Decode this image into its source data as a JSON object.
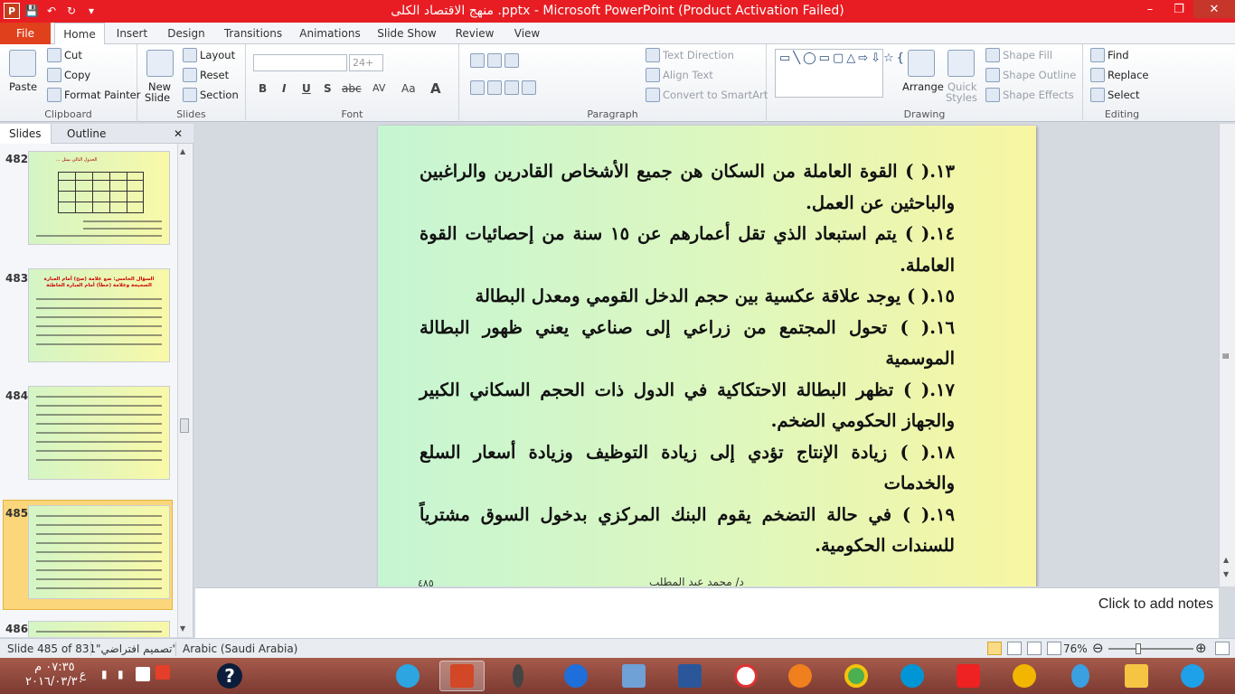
{
  "window": {
    "title": "منهج الاقتصاد الكلى .pptx - Microsoft PowerPoint (Product Activation Failed)",
    "minimize": "–",
    "restore": "❐",
    "close": "✕"
  },
  "qat": {
    "app_icon": "P",
    "save": "💾",
    "undo": "↶",
    "redo": "↻",
    "customize": "▾"
  },
  "tabs": [
    {
      "label": "File"
    },
    {
      "label": "Home"
    },
    {
      "label": "Insert"
    },
    {
      "label": "Design"
    },
    {
      "label": "Transitions"
    },
    {
      "label": "Animations"
    },
    {
      "label": "Slide Show"
    },
    {
      "label": "Review"
    },
    {
      "label": "View"
    }
  ],
  "ribbon": {
    "clipboard": {
      "label": "Clipboard",
      "paste": "Paste",
      "cut": "Cut",
      "copy": "Copy",
      "format_painter": "Format Painter"
    },
    "slides": {
      "label": "Slides",
      "new_slide_line1": "New",
      "new_slide_line2": "Slide",
      "layout": "Layout",
      "reset": "Reset",
      "section": "Section"
    },
    "font": {
      "label": "Font",
      "size": "24+",
      "bold": "B",
      "italic": "I",
      "underline": "U",
      "strike": "S",
      "abc": "abc",
      "av": "AV",
      "aa": "Aa",
      "color": "A"
    },
    "paragraph": {
      "label": "Paragraph",
      "text_direction": "Text Direction",
      "align_text": "Align Text",
      "smartart": "Convert to SmartArt"
    },
    "drawing": {
      "label": "Drawing",
      "arrange": "Arrange",
      "quick_styles_line1": "Quick",
      "quick_styles_line2": "Styles",
      "shape_fill": "Shape Fill",
      "shape_outline": "Shape Outline",
      "shape_effects": "Shape Effects"
    },
    "editing": {
      "label": "Editing",
      "find": "Find",
      "replace": "Replace",
      "select": "Select"
    }
  },
  "panel": {
    "tabs": [
      {
        "label": "Slides"
      },
      {
        "label": "Outline"
      }
    ],
    "close": "✕",
    "thumbs": [
      {
        "num": "482",
        "title": "الجدول التالي يمثل ..."
      },
      {
        "num": "483",
        "title": "السؤال الخامس: ضع علامة (صح) أمام العبارة الصحيحة وعلامة (خطأ) أمام العبارة الخاطئة"
      },
      {
        "num": "484",
        "title": ""
      },
      {
        "num": "485",
        "title": ""
      },
      {
        "num": "486",
        "title": ""
      }
    ]
  },
  "slide": {
    "lines": [
      "١٣.(      ) القوة العاملة من السكان هن جميع الأشخاص القادرين والراغبين والباحثين عن العمل.",
      "١٤.(      ) يتم استبعاد الذي تقل أعمارهم عن ١٥ سنة من إحصائيات القوة العاملة.",
      "١٥.(      ) يوجد علاقة عكسية بين حجم الدخل القومي ومعدل البطالة",
      "١٦.(      ) تحول المجتمع من زراعي إلى صناعي يعني ظهور البطالة الموسمية",
      "١٧.(      ) تظهر البطالة الاحتكاكية في الدول ذات الحجم السكاني الكبير والجهاز الحكومي الضخم.",
      "١٨.(      ) زيادة الإنتاج تؤدي إلى زيادة التوظيف وزيادة أسعار السلع والخدمات",
      "١٩.(      ) في حالة التضخم يقوم البنك المركزي بدخول السوق مشترياً للسندات الحكومية."
    ],
    "footer_number": "٤٨٥",
    "footer_name": "د/ محمد عبد المطلب"
  },
  "notes": {
    "placeholder": "Click to add notes"
  },
  "status": {
    "slide_info": "Slide 485 of 831",
    "theme": "\"تصميم افتراضي\"",
    "language": "Arabic (Saudi Arabia)",
    "zoom": "76%"
  },
  "taskbar": {
    "time": "٠٧:٣٥ م",
    "date": "٢٠١٦/٠٣/٣٠",
    "lang": "ع"
  },
  "colors": {
    "titlebar": "#e81d23",
    "file_tab": "#e0401c",
    "slide_bg_left": "#c6f5d3",
    "slide_bg_right": "#f8f6a2",
    "selection": "#fbd67b"
  }
}
